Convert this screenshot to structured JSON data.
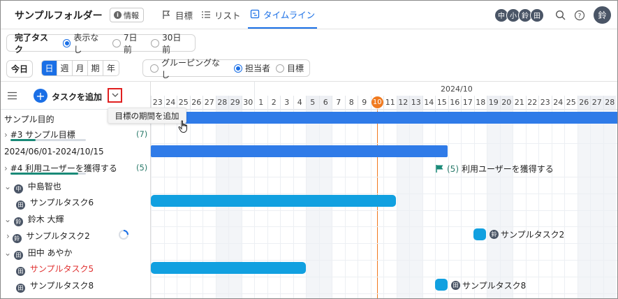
{
  "header": {
    "folder_title": "サンプルフォルダー",
    "info_label": "情報",
    "views": [
      {
        "label": "目標",
        "icon": "flag-icon"
      },
      {
        "label": "リスト",
        "icon": "list-icon"
      },
      {
        "label": "タイムライン",
        "icon": "timeline-icon"
      }
    ],
    "active_view": "タイムライン",
    "members": [
      "中",
      "小",
      "鈴",
      "田"
    ],
    "user_avatar": "鈴"
  },
  "toolbar1": {
    "label": "完了タスク",
    "options": [
      "表示なし",
      "7日前",
      "30日前"
    ],
    "selected": "表示なし"
  },
  "toolbar2": {
    "today_label": "今日",
    "scales": [
      "日",
      "週",
      "月",
      "期",
      "年"
    ],
    "active_scale": "日",
    "grouping_options": [
      "グルーピングなし",
      "担当者",
      "目標"
    ],
    "grouping_selected": "担当者"
  },
  "left_panel": {
    "add_task_label": "タスクを追加",
    "tooltip": "目標の期間を追加",
    "rows": {
      "goal_section": "サンプル目的",
      "goal1_title": "#3 サンプル目標",
      "goal1_count": "(7)",
      "goal2_period": "2024/06/01-2024/10/15",
      "goal2_title": "#4 利用ユーザーを獲得する",
      "goal2_count": "(5)",
      "person1": "中島智也",
      "person1_av": "中",
      "task1": "サンプルタスク6",
      "task1_av": "田",
      "person2": "鈴木 大輝",
      "person2_av": "鈴",
      "task2": "サンプルタスク2",
      "task2_av": "鈴",
      "person3": "田中 あやか",
      "person3_av": "田",
      "task3": "サンプルタスク5",
      "task3_av": "田",
      "task4": "サンプルタスク8",
      "task4_av": "田"
    }
  },
  "timeline": {
    "month_label": "2024/10",
    "days": [
      "23",
      "24",
      "25",
      "26",
      "27",
      "28",
      "29",
      "30",
      "1",
      "2",
      "3",
      "4",
      "5",
      "6",
      "7",
      "8",
      "9",
      "10",
      "11",
      "12",
      "13",
      "14",
      "15",
      "16",
      "17",
      "18",
      "19",
      "20",
      "21",
      "22",
      "23",
      "24",
      "25",
      "26",
      "27",
      "28"
    ],
    "weekend_days": [
      "28",
      "29",
      "5",
      "6",
      "12",
      "13",
      "19",
      "20",
      "26",
      "27"
    ],
    "today": "10",
    "goal2_label_count": "(5)",
    "goal2_label_text": "利用ユーザーを獲得する",
    "task2_label": "サンプルタスク2",
    "task2_label_av": "鈴",
    "task4_label": "サンプルタスク8",
    "task4_label_av": "田"
  },
  "colors": {
    "accent": "#1a6fe6",
    "goal_bar": "#2f7be8",
    "task_bar": "#11a0e0",
    "today": "#f07a1f",
    "overdue_text": "#e03030",
    "flag": "#1a8a78"
  }
}
